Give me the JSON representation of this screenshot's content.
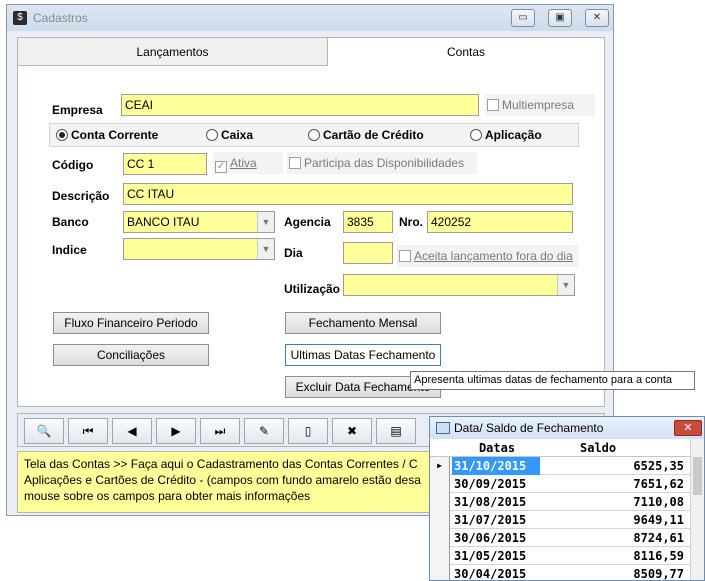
{
  "window": {
    "title": "Cadastros",
    "app_icon": "$"
  },
  "tabs": [
    {
      "label": "Lançamentos"
    },
    {
      "label": "Contas"
    }
  ],
  "form": {
    "empresa_label": "Empresa",
    "empresa_value": "CEAI",
    "multiempresa_label": "Multiempresa",
    "account_types": [
      "Conta Corrente",
      "Caixa",
      "Cartão de Crédito",
      "Aplicação"
    ],
    "selected_account_type": "Conta Corrente",
    "codigo_label": "Código",
    "codigo_value": "CC 1",
    "ativa_label": "Ativa",
    "ativa_checked": true,
    "participa_label": "Participa das Disponibilidades",
    "descricao_label": "Descrição",
    "descricao_value": "CC  ITAU",
    "banco_label": "Banco",
    "banco_value": "BANCO ITAU",
    "agencia_label": "Agencia",
    "agencia_value": "3835",
    "nro_label": "Nro.",
    "nro_value": "420252",
    "indice_label": "Indice",
    "indice_value": "",
    "dia_label": "Dia",
    "dia_value": "",
    "aceita_label": "Aceita lançamento fora do dia",
    "utilizacao_label": "Utilização",
    "utilizacao_value": ""
  },
  "buttons": {
    "fluxo": "Fluxo Financeiro Periodo",
    "conciliacoes": "Conciliações",
    "fechamento": "Fechamento Mensal",
    "ultimas": "Ultimas Datas Fechamento",
    "excluir": "Excluir Data Fechamento"
  },
  "tooltip": "Apresenta ultimas datas de fechamento para a conta",
  "status_text": "Tela das Contas >> Faça aqui o Cadastramento das Contas Correntes / C\nAplicações e Cartões de Crédito - (campos com fundo amarelo estão desa\nmouse sobre os campos para obter mais informações",
  "popup": {
    "title": "Data/ Saldo de Fechamento",
    "col_date": "Datas",
    "col_balance": "Saldo",
    "rows": [
      {
        "date": "31/10/2015",
        "balance": "6525,35"
      },
      {
        "date": "30/09/2015",
        "balance": "7651,62"
      },
      {
        "date": "31/08/2015",
        "balance": "7110,08"
      },
      {
        "date": "31/07/2015",
        "balance": "9649,11"
      },
      {
        "date": "30/06/2015",
        "balance": "8724,61"
      },
      {
        "date": "31/05/2015",
        "balance": "8116,59"
      },
      {
        "date": "30/04/2015",
        "balance": "8509,77"
      }
    ]
  }
}
